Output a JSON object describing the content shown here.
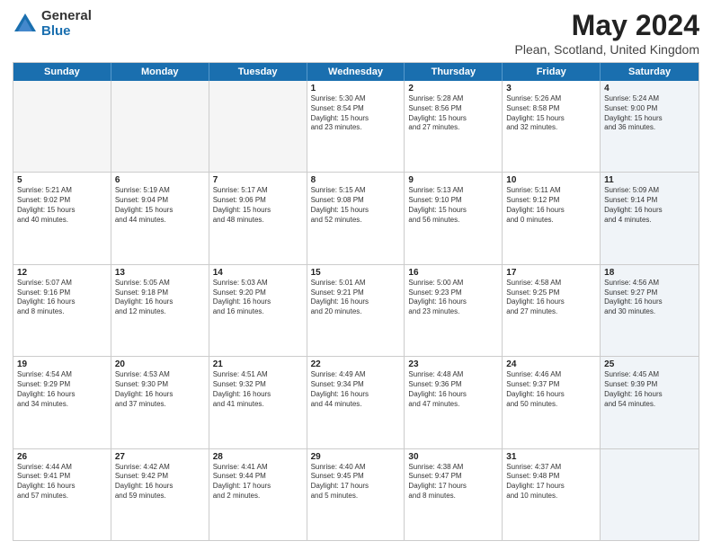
{
  "logo": {
    "general": "General",
    "blue": "Blue"
  },
  "header": {
    "title": "May 2024",
    "subtitle": "Plean, Scotland, United Kingdom"
  },
  "weekdays": [
    "Sunday",
    "Monday",
    "Tuesday",
    "Wednesday",
    "Thursday",
    "Friday",
    "Saturday"
  ],
  "weeks": [
    [
      {
        "day": "",
        "info": "",
        "empty": true
      },
      {
        "day": "",
        "info": "",
        "empty": true
      },
      {
        "day": "",
        "info": "",
        "empty": true
      },
      {
        "day": "1",
        "info": "Sunrise: 5:30 AM\nSunset: 8:54 PM\nDaylight: 15 hours\nand 23 minutes."
      },
      {
        "day": "2",
        "info": "Sunrise: 5:28 AM\nSunset: 8:56 PM\nDaylight: 15 hours\nand 27 minutes."
      },
      {
        "day": "3",
        "info": "Sunrise: 5:26 AM\nSunset: 8:58 PM\nDaylight: 15 hours\nand 32 minutes."
      },
      {
        "day": "4",
        "info": "Sunrise: 5:24 AM\nSunset: 9:00 PM\nDaylight: 15 hours\nand 36 minutes.",
        "shaded": true
      }
    ],
    [
      {
        "day": "5",
        "info": "Sunrise: 5:21 AM\nSunset: 9:02 PM\nDaylight: 15 hours\nand 40 minutes."
      },
      {
        "day": "6",
        "info": "Sunrise: 5:19 AM\nSunset: 9:04 PM\nDaylight: 15 hours\nand 44 minutes."
      },
      {
        "day": "7",
        "info": "Sunrise: 5:17 AM\nSunset: 9:06 PM\nDaylight: 15 hours\nand 48 minutes."
      },
      {
        "day": "8",
        "info": "Sunrise: 5:15 AM\nSunset: 9:08 PM\nDaylight: 15 hours\nand 52 minutes."
      },
      {
        "day": "9",
        "info": "Sunrise: 5:13 AM\nSunset: 9:10 PM\nDaylight: 15 hours\nand 56 minutes."
      },
      {
        "day": "10",
        "info": "Sunrise: 5:11 AM\nSunset: 9:12 PM\nDaylight: 16 hours\nand 0 minutes."
      },
      {
        "day": "11",
        "info": "Sunrise: 5:09 AM\nSunset: 9:14 PM\nDaylight: 16 hours\nand 4 minutes.",
        "shaded": true
      }
    ],
    [
      {
        "day": "12",
        "info": "Sunrise: 5:07 AM\nSunset: 9:16 PM\nDaylight: 16 hours\nand 8 minutes."
      },
      {
        "day": "13",
        "info": "Sunrise: 5:05 AM\nSunset: 9:18 PM\nDaylight: 16 hours\nand 12 minutes."
      },
      {
        "day": "14",
        "info": "Sunrise: 5:03 AM\nSunset: 9:20 PM\nDaylight: 16 hours\nand 16 minutes."
      },
      {
        "day": "15",
        "info": "Sunrise: 5:01 AM\nSunset: 9:21 PM\nDaylight: 16 hours\nand 20 minutes."
      },
      {
        "day": "16",
        "info": "Sunrise: 5:00 AM\nSunset: 9:23 PM\nDaylight: 16 hours\nand 23 minutes."
      },
      {
        "day": "17",
        "info": "Sunrise: 4:58 AM\nSunset: 9:25 PM\nDaylight: 16 hours\nand 27 minutes."
      },
      {
        "day": "18",
        "info": "Sunrise: 4:56 AM\nSunset: 9:27 PM\nDaylight: 16 hours\nand 30 minutes.",
        "shaded": true
      }
    ],
    [
      {
        "day": "19",
        "info": "Sunrise: 4:54 AM\nSunset: 9:29 PM\nDaylight: 16 hours\nand 34 minutes."
      },
      {
        "day": "20",
        "info": "Sunrise: 4:53 AM\nSunset: 9:30 PM\nDaylight: 16 hours\nand 37 minutes."
      },
      {
        "day": "21",
        "info": "Sunrise: 4:51 AM\nSunset: 9:32 PM\nDaylight: 16 hours\nand 41 minutes."
      },
      {
        "day": "22",
        "info": "Sunrise: 4:49 AM\nSunset: 9:34 PM\nDaylight: 16 hours\nand 44 minutes."
      },
      {
        "day": "23",
        "info": "Sunrise: 4:48 AM\nSunset: 9:36 PM\nDaylight: 16 hours\nand 47 minutes."
      },
      {
        "day": "24",
        "info": "Sunrise: 4:46 AM\nSunset: 9:37 PM\nDaylight: 16 hours\nand 50 minutes."
      },
      {
        "day": "25",
        "info": "Sunrise: 4:45 AM\nSunset: 9:39 PM\nDaylight: 16 hours\nand 54 minutes.",
        "shaded": true
      }
    ],
    [
      {
        "day": "26",
        "info": "Sunrise: 4:44 AM\nSunset: 9:41 PM\nDaylight: 16 hours\nand 57 minutes."
      },
      {
        "day": "27",
        "info": "Sunrise: 4:42 AM\nSunset: 9:42 PM\nDaylight: 16 hours\nand 59 minutes."
      },
      {
        "day": "28",
        "info": "Sunrise: 4:41 AM\nSunset: 9:44 PM\nDaylight: 17 hours\nand 2 minutes."
      },
      {
        "day": "29",
        "info": "Sunrise: 4:40 AM\nSunset: 9:45 PM\nDaylight: 17 hours\nand 5 minutes."
      },
      {
        "day": "30",
        "info": "Sunrise: 4:38 AM\nSunset: 9:47 PM\nDaylight: 17 hours\nand 8 minutes."
      },
      {
        "day": "31",
        "info": "Sunrise: 4:37 AM\nSunset: 9:48 PM\nDaylight: 17 hours\nand 10 minutes."
      },
      {
        "day": "",
        "info": "",
        "empty": true,
        "shaded": true
      }
    ]
  ]
}
